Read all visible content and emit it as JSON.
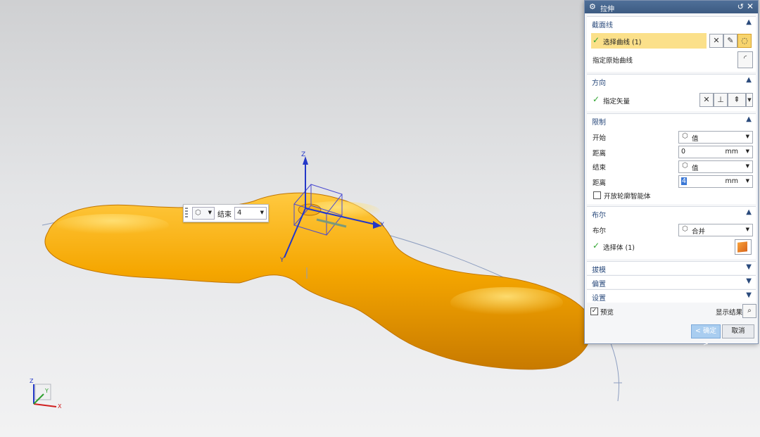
{
  "dialog": {
    "title": "拉伸",
    "title_icons": {
      "gear": "⚙",
      "reset": "↺",
      "close": "✕"
    },
    "section_curve": {
      "title": "截面线",
      "select_curve": "选择曲线 (1)",
      "specify_origin_curve": "指定原始曲线"
    },
    "direction": {
      "title": "方向",
      "specify_vector": "指定矢量"
    },
    "limits": {
      "title": "限制",
      "start_label": "开始",
      "start_value": "值",
      "distance1_label": "距离",
      "distance1_value": "0",
      "distance1_unit": "mm",
      "end_label": "结束",
      "end_value": "值",
      "distance2_label": "距离",
      "distance2_value": "4",
      "distance2_unit": "mm",
      "open_profile": "开放轮廓智能体"
    },
    "boolean": {
      "title": "布尔",
      "boolean_label": "布尔",
      "boolean_value": "合并",
      "select_body": "选择体 (1)"
    },
    "draft": {
      "title": "拔模"
    },
    "offset": {
      "title": "偏置"
    },
    "settings": {
      "title": "设置"
    },
    "preview": {
      "label": "预览",
      "checked": true,
      "show_result": "显示结果"
    },
    "buttons": {
      "ok": "< 确定 >",
      "cancel": "取消"
    }
  },
  "onscreen_input": {
    "label": "结束",
    "value": "4"
  },
  "viewport": {
    "axis_labels": {
      "z": "Z",
      "x": "X",
      "y": "Y"
    },
    "triad_labels": {
      "z": "Z",
      "x": "X",
      "y": "Y"
    },
    "colors": {
      "part": "#f5a800",
      "accent": "#3d5b82"
    }
  }
}
